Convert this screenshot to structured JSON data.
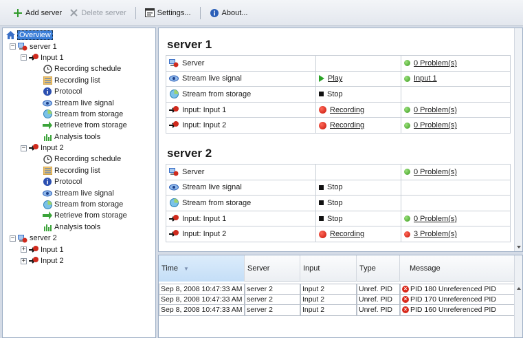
{
  "toolbar": {
    "add_server": "Add server",
    "delete_server": "Delete server",
    "settings": "Settings...",
    "about": "About..."
  },
  "tree": {
    "overview": "Overview",
    "servers": [
      {
        "label": "server 1",
        "inputs": [
          {
            "label": "Input 1",
            "items": [
              "Recording schedule",
              "Recording list",
              "Protocol",
              "Stream live signal",
              "Stream from storage",
              "Retrieve from storage",
              "Analysis tools"
            ]
          },
          {
            "label": "Input 2",
            "items": [
              "Recording schedule",
              "Recording list",
              "Protocol",
              "Stream live signal",
              "Stream from storage",
              "Retrieve from storage",
              "Analysis tools"
            ]
          }
        ]
      },
      {
        "label": "server 2",
        "inputs": [
          {
            "label": "Input 1",
            "items": []
          },
          {
            "label": "Input 2",
            "items": []
          }
        ]
      }
    ]
  },
  "overview": {
    "servers": [
      {
        "title": "server 1",
        "rows": [
          {
            "name": "Server",
            "action": "",
            "status": "0 Problem(s)"
          },
          {
            "name": "Stream live signal",
            "action": "Play",
            "status": "Input 1"
          },
          {
            "name": "Stream from storage",
            "action": "Stop",
            "status": ""
          },
          {
            "name": "Input: Input 1",
            "action": "Recording",
            "status": "0 Problem(s)"
          },
          {
            "name": "Input: Input 2",
            "action": "Recording",
            "status": "0 Problem(s)"
          }
        ]
      },
      {
        "title": "server 2",
        "rows": [
          {
            "name": "Server",
            "action": "",
            "status": "0 Problem(s)"
          },
          {
            "name": "Stream live signal",
            "action": "Stop",
            "status": ""
          },
          {
            "name": "Stream from storage",
            "action": "Stop",
            "status": ""
          },
          {
            "name": "Input: Input 1",
            "action": "Stop",
            "status": "0 Problem(s)"
          },
          {
            "name": "Input: Input 2",
            "action": "Recording",
            "status": "3 Problem(s)"
          }
        ]
      }
    ]
  },
  "log": {
    "columns": [
      "Time",
      "Server",
      "Input",
      "Type",
      "Message"
    ],
    "rows": [
      {
        "time": "Sep 8, 2008 10:47:33 AM",
        "server": "server 2",
        "input": "Input 2",
        "type": "Unref. PID",
        "message": "PID 180 Unreferenced PID"
      },
      {
        "time": "Sep 8, 2008 10:47:33 AM",
        "server": "server 2",
        "input": "Input 2",
        "type": "Unref. PID",
        "message": "PID 170 Unreferenced PID"
      },
      {
        "time": "Sep 8, 2008 10:47:33 AM",
        "server": "server 2",
        "input": "Input 2",
        "type": "Unref. PID",
        "message": "PID 160 Unreferenced PID"
      }
    ]
  },
  "colors": {
    "ok": "#3a9b1e",
    "error": "#c51206",
    "selection": "#3c7fd8"
  }
}
